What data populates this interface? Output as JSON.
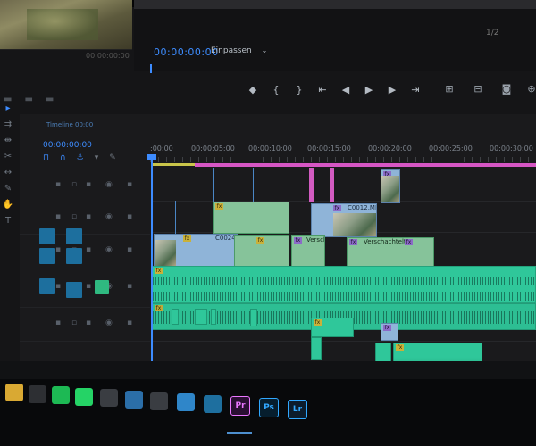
{
  "monitor": {
    "timecode": "00:00:00:00",
    "fit_label": "Einpassen",
    "fit_chevron": "⌄",
    "ratio": "1/2",
    "left_timecode": "00:00:00:00"
  },
  "transport": {
    "buttons": [
      {
        "name": "mark-in-icon",
        "glyph": "◆"
      },
      {
        "name": "mark-out-left-icon",
        "glyph": "{"
      },
      {
        "name": "mark-out-right-icon",
        "glyph": "}"
      },
      {
        "name": "go-to-in-icon",
        "glyph": "⇤"
      },
      {
        "name": "step-back-icon",
        "glyph": "◀"
      },
      {
        "name": "play-icon",
        "glyph": "▶"
      },
      {
        "name": "step-forward-icon",
        "glyph": "▶"
      },
      {
        "name": "go-to-out-icon",
        "glyph": "⇥"
      }
    ],
    "right_buttons": [
      {
        "name": "lift-icon",
        "glyph": "⊞"
      },
      {
        "name": "extract-icon",
        "glyph": "⊟"
      },
      {
        "name": "export-frame-icon",
        "glyph": "◙"
      },
      {
        "name": "settings-icon",
        "glyph": "⊕"
      }
    ]
  },
  "timeline": {
    "sequence_tab": "Timeline 00:00",
    "timecode": "00:00:00:00",
    "ruler": [
      ":00:00",
      "00:00:05:00",
      "00:00:10:00",
      "00:00:15:00",
      "00:00:20:00",
      "00:00:25:00",
      "00:00:30:00"
    ],
    "clips": {
      "c0012": "C0012.MP4",
      "c0024": "C0024",
      "nested1": "Verschachtel",
      "nested2": "Verschachtelt",
      "fx": "fx"
    }
  },
  "taskbar": {
    "apps": [
      {
        "name": "file-explorer-icon",
        "label": "",
        "color": "#d9a933"
      },
      {
        "name": "app-icon-2",
        "label": "",
        "color": "#2d2f33"
      },
      {
        "name": "spotify-icon",
        "label": "",
        "color": "#1db954"
      },
      {
        "name": "whatsapp-icon",
        "label": "",
        "color": "#25d366"
      },
      {
        "name": "app-icon-5",
        "label": "",
        "color": "#3a3d42"
      },
      {
        "name": "app-icon-6",
        "label": "",
        "color": "#2b6ea8"
      },
      {
        "name": "app-icon-7",
        "label": "",
        "color": "#3a3d42"
      },
      {
        "name": "app-icon-8",
        "label": "",
        "color": "#2f86c9"
      },
      {
        "name": "app-icon-9",
        "label": "",
        "color": "#1e6f9f"
      },
      {
        "name": "premiere-pro-icon",
        "label": "Pr",
        "color": "#2a0f33"
      },
      {
        "name": "photoshop-icon",
        "label": "Ps",
        "color": "#061e2e"
      },
      {
        "name": "lightroom-icon",
        "label": "Lr",
        "color": "#0c1c2c"
      }
    ]
  },
  "colors": {
    "accent_blue": "#3d8cff",
    "video_clip": "#8fb4d8",
    "audio_clip": "#2fc79a",
    "marker_pink": "#d656c4",
    "work_area": "#c9c54a"
  }
}
